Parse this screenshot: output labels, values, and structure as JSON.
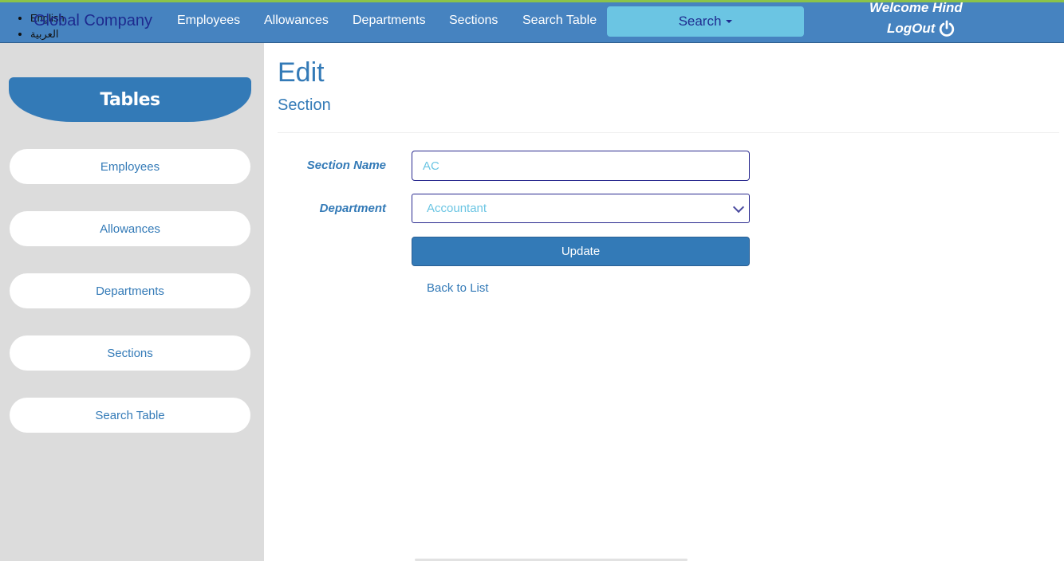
{
  "header": {
    "languages": [
      "English",
      "العربية"
    ],
    "brand": "Global Company",
    "nav": [
      "Employees",
      "Allowances",
      "Departments",
      "Sections",
      "Search Table"
    ],
    "search_label": "Search",
    "welcome": "Welcome Hind",
    "logout": "LogOut"
  },
  "sidebar": {
    "title": "Tables",
    "items": [
      "Employees",
      "Allowances",
      "Departments",
      "Sections",
      "Search Table"
    ]
  },
  "main": {
    "title": "Edit",
    "subtitle": "Section",
    "form": {
      "section_name_label": "Section Name",
      "section_name_value": "AC",
      "department_label": "Department",
      "department_value": "Accountant",
      "update_label": "Update",
      "back_label": "Back to List"
    }
  },
  "colors": {
    "navbar": "#4683c0",
    "accent": "#337ab7",
    "search_button": "#6bc5e3",
    "sidebar_bg": "#dcdcdc"
  }
}
